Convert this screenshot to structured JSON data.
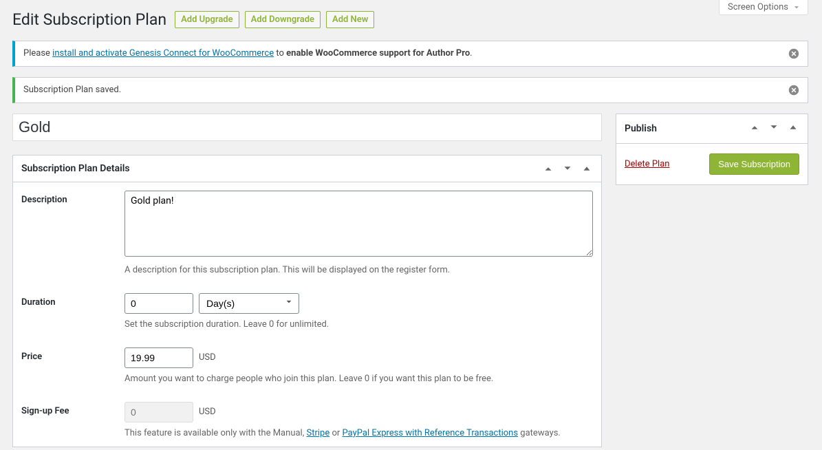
{
  "screen_options_label": "Screen Options",
  "page_title": "Edit Subscription Plan",
  "header_buttons": {
    "upgrade": "Add Upgrade",
    "downgrade": "Add Downgrade",
    "add_new": "Add New"
  },
  "notice_info": {
    "please": "Please ",
    "link_text": "install and activate Genesis Connect for WooCommerce",
    "middle": " to ",
    "bold": "enable WooCommerce support for Author Pro",
    "end": "."
  },
  "notice_success": "Subscription Plan saved.",
  "title_value": "Gold",
  "details_panel_title": "Subscription Plan Details",
  "fields": {
    "description": {
      "label": "Description",
      "value": "Gold plan!",
      "help": "A description for this subscription plan. This will be displayed on the register form."
    },
    "duration": {
      "label": "Duration",
      "value": "0",
      "unit": "Day(s)",
      "help": "Set the subscription duration. Leave 0 for unlimited."
    },
    "price": {
      "label": "Price",
      "value": "19.99",
      "currency": "USD",
      "help": "Amount you want to charge people who join this plan. Leave 0 if you want this plan to be free."
    },
    "signup_fee": {
      "label": "Sign-up Fee",
      "placeholder": "0",
      "currency": "USD",
      "help_pre": "This feature is available only with the Manual, ",
      "help_link1": "Stripe",
      "help_mid": " or ",
      "help_link2": "PayPal Express with Reference Transactions",
      "help_post": " gateways."
    }
  },
  "publish": {
    "title": "Publish",
    "delete": "Delete Plan",
    "save": "Save Subscription"
  }
}
